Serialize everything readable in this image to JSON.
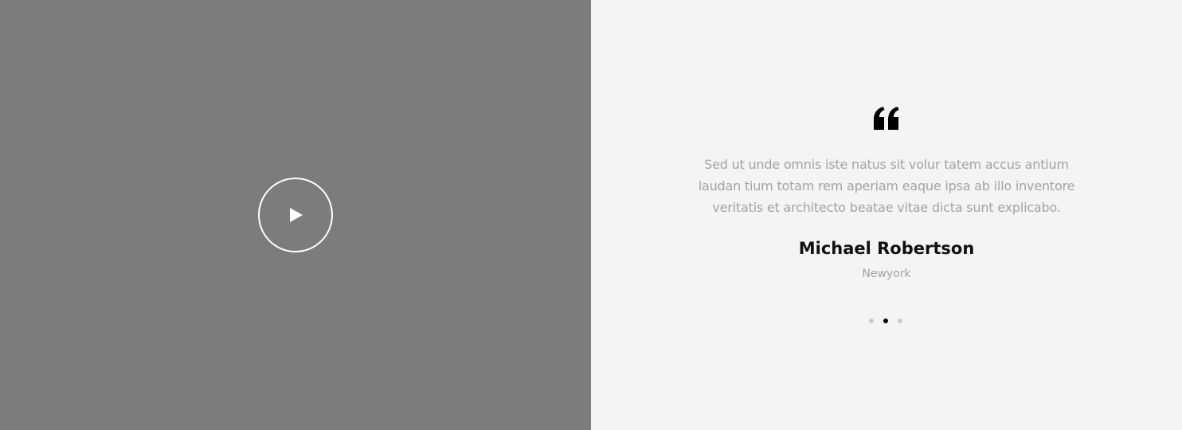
{
  "video": {
    "play_icon": "play-icon"
  },
  "testimonial": {
    "quote_icon": "quote-icon",
    "text": "Sed ut unde omnis iste natus sit volur tatem accus antium laudan tium totam rem aperiam eaque ipsa ab illo inventore veritatis et architecto beatae vitae dicta sunt explicabo.",
    "author_name": "Michael Robertson",
    "author_location": "Newyork"
  },
  "pagination": {
    "dot_count": 3,
    "active_index": 1
  },
  "colors": {
    "video_bg": "#7b7c7e",
    "panel_bg": "#f4f4f4",
    "muted_text": "#a3a3a3",
    "heading": "#111111",
    "dot_inactive": "#c9c9c9",
    "dot_active": "#000000"
  }
}
